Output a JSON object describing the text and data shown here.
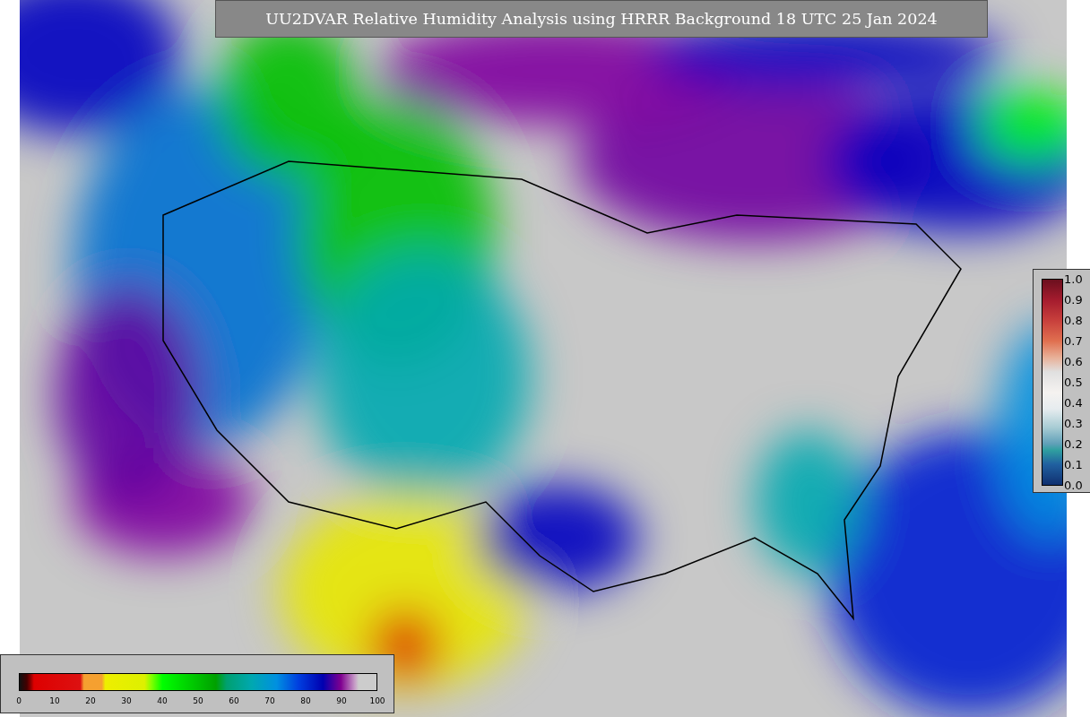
{
  "title": "UU2DVAR Relative Humidity Analysis using HRRR Background 18 UTC 25 Jan 2024",
  "humidity_colorbar": {
    "ticks": [
      "0",
      "10",
      "20",
      "30",
      "40",
      "50",
      "60",
      "70",
      "80",
      "90",
      "100"
    ]
  },
  "station_colorbar": {
    "ticks": [
      "1.0",
      "0.9",
      "0.8",
      "0.7",
      "0.6",
      "0.5",
      "0.4",
      "0.3",
      "0.2",
      "0.1",
      "0.0"
    ]
  }
}
